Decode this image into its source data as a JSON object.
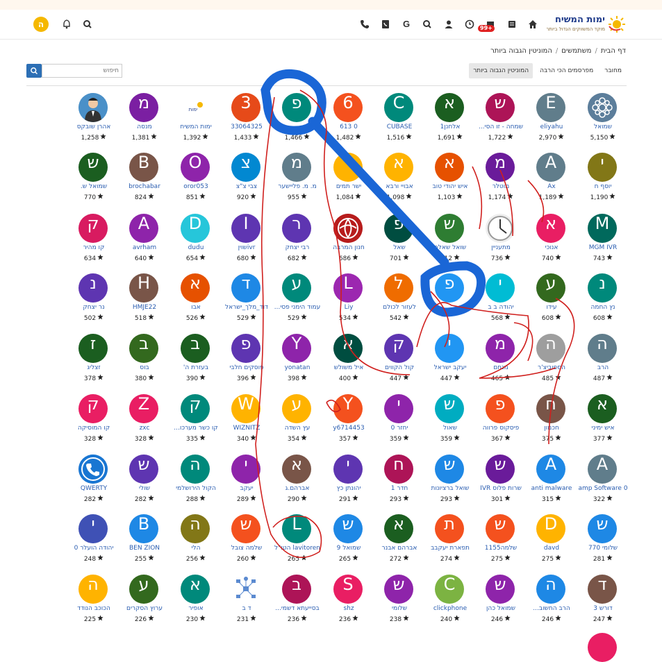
{
  "header": {
    "logo_title": "ימות המשיח",
    "logo_subtitle": "מוקד המשווקים הגדול ביותר",
    "notification_count": "99+",
    "user_initial": "ה",
    "icons": [
      "home-icon",
      "card-icon",
      "chat-icon",
      "clock-icon",
      "user-icon",
      "search-icon",
      "google-icon",
      "phone-book-icon",
      "phone-icon"
    ]
  },
  "breadcrumb": {
    "home": "דף הבית",
    "users": "משתמשים",
    "current": "המוניטין הגבוה ביותר"
  },
  "tabs": [
    "מחובר",
    "מפרסמים הכי הרבה",
    "המוניטין הגבוה ביותר"
  ],
  "search": {
    "placeholder": "חיפוש"
  },
  "users": [
    [
      {
        "name": "שמואל",
        "rep": "5,150",
        "letter": "",
        "color": "#5c7e9b",
        "kind": "gear"
      },
      {
        "name": "eliyahu",
        "rep": "2,970",
        "letter": "E",
        "color": "#607d8b"
      },
      {
        "name": "שמחה - זו הסי...",
        "rep": "1,722",
        "letter": "ש",
        "color": "#ad1457"
      },
      {
        "name": "אלחנן1",
        "rep": "1,691",
        "letter": "א",
        "color": "#1b5e20"
      },
      {
        "name": "CUBASE",
        "rep": "1,516",
        "letter": "C",
        "color": "#00897b"
      },
      {
        "name": "0 613",
        "rep": "1,482",
        "letter": "6",
        "color": "#f4511e"
      },
      {
        "name": "",
        "rep": "1,466",
        "letter": "פ",
        "color": "#00897b"
      },
      {
        "name": "33064325",
        "rep": "1,433",
        "letter": "3",
        "color": "#e64a19"
      },
      {
        "name": "ימות המשיח",
        "rep": "1,392",
        "letter": "",
        "color": "#ffffff",
        "kind": "logo"
      },
      {
        "name": "מנסה",
        "rep": "1,381",
        "letter": "מ",
        "color": "#7b1fa2"
      },
      {
        "name": "אהרן שובקס",
        "rep": "1,258",
        "letter": "",
        "color": "#4a90c8",
        "kind": "man"
      }
    ],
    [
      {
        "name": "יוסף ח",
        "rep": "1,190",
        "letter": "י",
        "color": "#827717"
      },
      {
        "name": "Ax",
        "rep": "1,189",
        "letter": "A",
        "color": "#607d8b"
      },
      {
        "name": "מוטלר",
        "rep": "1,174",
        "letter": "מ",
        "color": "#6a1b9a"
      },
      {
        "name": "איש יהודי טוב",
        "rep": "1,103",
        "letter": "א",
        "color": "#e65100"
      },
      {
        "name": "אבויי ורבא",
        "rep": "1,098",
        "letter": "א",
        "color": "#ffb300"
      },
      {
        "name": "ישר תמים",
        "rep": "1,084",
        "letter": "י",
        "color": "#ffb300"
      },
      {
        "name": "מ. מ. פליישער",
        "rep": "955",
        "letter": "מ",
        "color": "#607d8b"
      },
      {
        "name": "צבי צ\"צ",
        "rep": "920",
        "letter": "צ",
        "color": "#0288d1"
      },
      {
        "name": "oror053",
        "rep": "851",
        "letter": "O",
        "color": "#8e24aa"
      },
      {
        "name": "brochabar",
        "rep": "824",
        "letter": "B",
        "color": "#795548"
      },
      {
        "name": "שמואל ש.",
        "rep": "770",
        "letter": "ש",
        "color": "#1b5e20"
      }
    ],
    [
      {
        "name": "MGM IVR",
        "rep": "743",
        "letter": "M",
        "color": "#00695c"
      },
      {
        "name": "אנוכי",
        "rep": "740",
        "letter": "א",
        "color": "#e91e63"
      },
      {
        "name": "מתעניין",
        "rep": "736",
        "letter": "",
        "color": "#ffffff",
        "kind": "clock"
      },
      {
        "name": "שואל שאלה",
        "rep": "712",
        "letter": "ש",
        "color": "#2e7d32"
      },
      {
        "name": "שאל",
        "rep": "701",
        "letter": "פ",
        "color": "#004d40"
      },
      {
        "name": "חנון המרבה",
        "rep": "686",
        "letter": "",
        "color": "#b71c1c",
        "kind": "emblem"
      },
      {
        "name": "רבי יצחק",
        "rep": "682",
        "letter": "ר",
        "color": "#5e35b1"
      },
      {
        "name": "ivrשוין",
        "rep": "680",
        "letter": "I",
        "color": "#5e35b1"
      },
      {
        "name": "dudu",
        "rep": "654",
        "letter": "D",
        "color": "#26c6da"
      },
      {
        "name": "avrham",
        "rep": "640",
        "letter": "A",
        "color": "#8e24aa"
      },
      {
        "name": "קו מהיר",
        "rep": "634",
        "letter": "ק",
        "color": "#d81b60"
      }
    ],
    [
      {
        "name": "נץ החמה",
        "rep": "608",
        "letter": "נ",
        "color": "#00897b"
      },
      {
        "name": "עידו",
        "rep": "608",
        "letter": "ע",
        "color": "#33691e"
      },
      {
        "name": "יהודה ב ב",
        "rep": "568",
        "letter": "י",
        "color": "#00bcd4"
      },
      {
        "name": "",
        "rep": "",
        "letter": "פ",
        "color": "#2196f3"
      },
      {
        "name": "לעזור לכולם",
        "rep": "542",
        "letter": "ל",
        "color": "#ef6c00"
      },
      {
        "name": "Liy",
        "rep": "534",
        "letter": "L",
        "color": "#9c27b0"
      },
      {
        "name": "עמוד הימני פסי...",
        "rep": "529",
        "letter": "ע",
        "color": "#00897b"
      },
      {
        "name": "דוד_מלך_ישראל",
        "rep": "529",
        "letter": "ד",
        "color": "#1e88e5"
      },
      {
        "name": "אבו",
        "rep": "526",
        "letter": "א",
        "color": "#e65100"
      },
      {
        "name": "HMJE22",
        "rep": "518",
        "letter": "H",
        "color": "#795548"
      },
      {
        "name": "נר יצחק",
        "rep": "502",
        "letter": "נ",
        "color": "#5e35b1"
      }
    ],
    [
      {
        "name": "הרב",
        "rep": "487",
        "letter": "ה",
        "color": "#607d8b"
      },
      {
        "name": "הספוביצ'ר",
        "rep": "485",
        "letter": "ה",
        "color": "#9e9e9e"
      },
      {
        "name": "מנחם",
        "rep": "465",
        "letter": "מ",
        "color": "#8e24aa"
      },
      {
        "name": "יעקב ישראל",
        "rep": "447",
        "letter": "י",
        "color": "#2196f3"
      },
      {
        "name": "קול הקווים",
        "rep": "447",
        "letter": "ק",
        "color": "#5e35b1"
      },
      {
        "name": "איל משולש",
        "rep": "400",
        "letter": "א",
        "color": "#004d40"
      },
      {
        "name": "yonatan",
        "rep": "398",
        "letter": "Y",
        "color": "#8e24aa"
      },
      {
        "name": "פוסקים חלבי",
        "rep": "396",
        "letter": "פ",
        "color": "#5e35b1"
      },
      {
        "name": "בעזרת ה'",
        "rep": "390",
        "letter": "ב",
        "color": "#1b5e20"
      },
      {
        "name": "בוס",
        "rep": "380",
        "letter": "ב",
        "color": "#33691e"
      },
      {
        "name": "זצליג",
        "rep": "378",
        "letter": "ז",
        "color": "#1b5e20"
      }
    ],
    [
      {
        "name": "איש ימיני",
        "rep": "377",
        "letter": "א",
        "color": "#1b5e20"
      },
      {
        "name": "חכמון",
        "rep": "375",
        "letter": "ח",
        "color": "#795548"
      },
      {
        "name": "פיסקוס פרווה",
        "rep": "367",
        "letter": "פ",
        "color": "#f4511e"
      },
      {
        "name": "שאול",
        "rep": "359",
        "letter": "ש",
        "color": "#00acc1"
      },
      {
        "name": "יחזר 0",
        "rep": "359",
        "letter": "י",
        "color": "#8e24aa"
      },
      {
        "name": "y6714453",
        "rep": "357",
        "letter": "Y",
        "color": "#f4511e"
      },
      {
        "name": "עץ השדה",
        "rep": "354",
        "letter": "ע",
        "color": "#ffb300"
      },
      {
        "name": "WIZNITZ",
        "rep": "340",
        "letter": "W",
        "color": "#ffb300"
      },
      {
        "name": "קו כשר מערכו...",
        "rep": "335",
        "letter": "ק",
        "color": "#00897b"
      },
      {
        "name": "zxc",
        "rep": "328",
        "letter": "Z",
        "color": "#e91e63"
      },
      {
        "name": "קו המוסיקה",
        "rep": "328",
        "letter": "ק",
        "color": "#e91e63"
      }
    ],
    [
      {
        "name": "amp Software 0",
        "rep": "322",
        "letter": "A",
        "color": "#607d8b"
      },
      {
        "name": "anti malware",
        "rep": "315",
        "letter": "A",
        "color": "#1e88e5"
      },
      {
        "name": "שרות פלוס IVR",
        "rep": "301",
        "letter": "ש",
        "color": "#6a1b9a"
      },
      {
        "name": "שואל ברציונות",
        "rep": "293",
        "letter": "ש",
        "color": "#1e88e5"
      },
      {
        "name": "חדר 1",
        "rep": "293",
        "letter": "ח",
        "color": "#ad1457"
      },
      {
        "name": "יהונתן כץ",
        "rep": "291",
        "letter": "י",
        "color": "#5e35b1"
      },
      {
        "name": "אברהם.ג",
        "rep": "290",
        "letter": "א",
        "color": "#795548"
      },
      {
        "name": "יעקב",
        "rep": "289",
        "letter": "י",
        "color": "#8e24aa"
      },
      {
        "name": "הקול הירושלמי",
        "rep": "288",
        "letter": "ה",
        "color": "#00897b"
      },
      {
        "name": "שולי",
        "rep": "282",
        "letter": "ש",
        "color": "#5e35b1"
      },
      {
        "name": "QWERTY",
        "rep": "282",
        "letter": "",
        "color": "#1976d2",
        "kind": "phone"
      }
    ],
    [
      {
        "name": "שלומי 770",
        "rep": "281",
        "letter": "ש",
        "color": "#1e88e5"
      },
      {
        "name": "davd",
        "rep": "275",
        "letter": "D",
        "color": "#ffb300"
      },
      {
        "name": "שלמה1155",
        "rep": "275",
        "letter": "ש",
        "color": "#f4511e"
      },
      {
        "name": "תפארת יעקבב",
        "rep": "274",
        "letter": "ת",
        "color": "#f4511e"
      },
      {
        "name": "אברהם אבנר",
        "rep": "272",
        "letter": "א",
        "color": "#1b5e20"
      },
      {
        "name": "שמואל 9",
        "rep": "265",
        "letter": "ש",
        "color": "#1e88e5"
      },
      {
        "name": "lavitoren הטו\"ל",
        "rep": "265",
        "letter": "L",
        "color": "#00897b"
      },
      {
        "name": "שלמה צובל",
        "rep": "260",
        "letter": "ש",
        "color": "#f4511e"
      },
      {
        "name": "הלי",
        "rep": "256",
        "letter": "ה",
        "color": "#827717"
      },
      {
        "name": "BEN ZION",
        "rep": "255",
        "letter": "B",
        "color": "#1e88e5"
      },
      {
        "name": "יהודה הועלר 0",
        "rep": "248",
        "letter": "י",
        "color": "#3f51b5"
      }
    ],
    [
      {
        "name": "דורש 3",
        "rep": "247",
        "letter": "ד",
        "color": "#795548"
      },
      {
        "name": "הרב החשוב...",
        "rep": "246",
        "letter": "ה",
        "color": "#1e88e5"
      },
      {
        "name": "שמואל כהן",
        "rep": "246",
        "letter": "ש",
        "color": "#8e24aa"
      },
      {
        "name": "clickphone",
        "rep": "240",
        "letter": "C",
        "color": "#7cb342"
      },
      {
        "name": "שלומי",
        "rep": "238",
        "letter": "ש",
        "color": "#8e24aa"
      },
      {
        "name": "shz",
        "rep": "236",
        "letter": "S",
        "color": "#e91e63"
      },
      {
        "name": "בסייעתא דשמי...",
        "rep": "236",
        "letter": "ב",
        "color": "#ad1457"
      },
      {
        "name": "ד ב",
        "rep": "231",
        "letter": "",
        "color": "#ffffff",
        "kind": "network"
      },
      {
        "name": "אופיר",
        "rep": "230",
        "letter": "א",
        "color": "#00897b"
      },
      {
        "name": "ערוץ הסקרים",
        "rep": "226",
        "letter": "ע",
        "color": "#33691e"
      },
      {
        "name": "הכוכב הנודד",
        "rep": "225",
        "letter": "ה",
        "color": "#ffb300"
      }
    ]
  ]
}
